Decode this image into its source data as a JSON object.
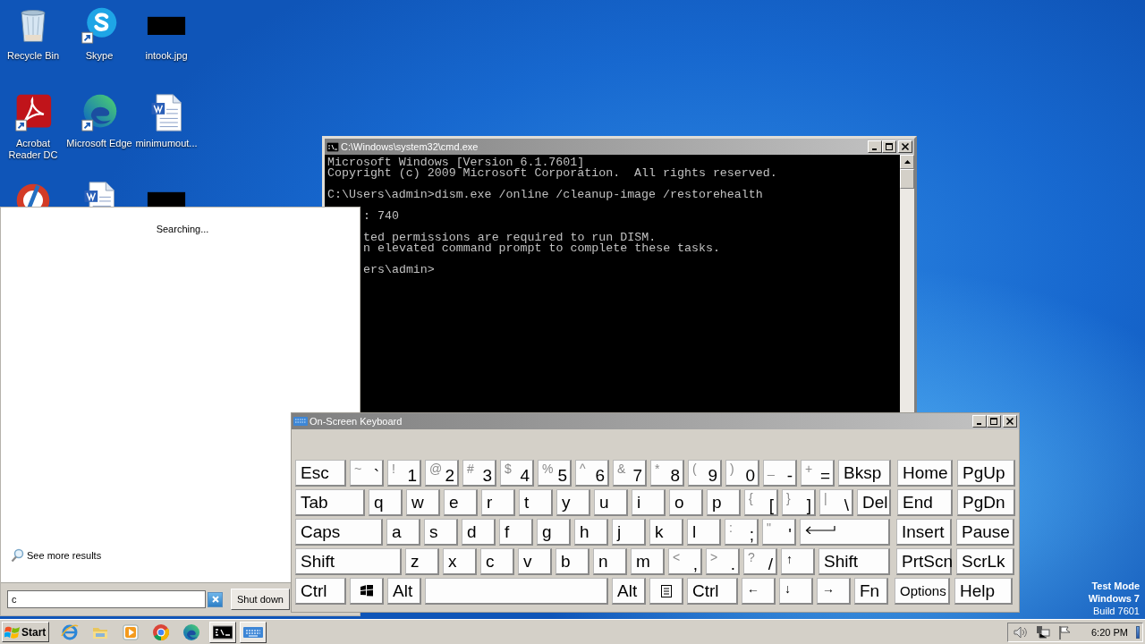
{
  "desktop": {
    "icons": [
      {
        "kind": "recycle",
        "label": "Recycle Bin",
        "shortcut": false
      },
      {
        "kind": "skype",
        "label": "Skype",
        "shortcut": true
      },
      {
        "kind": "image",
        "label": "intook.jpg",
        "shortcut": false
      },
      {
        "kind": "acrobat",
        "label": "Acrobat Reader DC",
        "shortcut": true
      },
      {
        "kind": "edge",
        "label": "Microsoft Edge",
        "shortcut": true
      },
      {
        "kind": "word",
        "label": "minimumout...",
        "shortcut": false
      },
      {
        "kind": "ccleaner"
      },
      {
        "kind": "word"
      },
      {
        "kind": "image"
      }
    ],
    "test_mode": [
      "Test Mode",
      "Windows 7",
      "Build 7601"
    ]
  },
  "cmd_window": {
    "title": "C:\\Windows\\system32\\cmd.exe",
    "blocks": [
      [
        {
          "text": "Microsoft Windows [Version 6.1.7601]",
          "cut": false
        },
        {
          "text": "Copyright (c) 2009 Microsoft Corporation.  All rights reserved.",
          "cut": false
        }
      ],
      [
        {
          "text": "C:\\Users\\admin>dism.exe /online /cleanup-image /restorehealth",
          "cut": false
        }
      ],
      [
        {
          "text": ": 740",
          "cut": true
        }
      ],
      [
        {
          "text": "ted permissions are required to run DISM.",
          "cut": true
        },
        {
          "text": "n elevated command prompt to complete these tasks.",
          "cut": true
        }
      ],
      [
        {
          "text": "ers\\admin>",
          "cut": true
        }
      ]
    ]
  },
  "start_menu": {
    "status": "Searching...",
    "see_more": "See more results",
    "search": {
      "value": "c"
    },
    "shutdown": "Shut down"
  },
  "keyboard_window": {
    "title": "On-Screen Keyboard",
    "rows": [
      {
        "keys": [
          {
            "kind": "esc",
            "label": "Esc"
          },
          {
            "kind": "key",
            "shift": "~",
            "label": "`"
          },
          {
            "kind": "key",
            "shift": "!",
            "label": "1"
          },
          {
            "kind": "key",
            "shift": "@",
            "label": "2"
          },
          {
            "kind": "key",
            "shift": "#",
            "label": "3"
          },
          {
            "kind": "key",
            "shift": "$",
            "label": "4"
          },
          {
            "kind": "key",
            "shift": "%",
            "label": "5"
          },
          {
            "kind": "key",
            "shift": "^",
            "label": "6"
          },
          {
            "kind": "key",
            "shift": "&",
            "label": "7"
          },
          {
            "kind": "key",
            "shift": "*",
            "label": "8"
          },
          {
            "kind": "key",
            "shift": "(",
            "label": "9"
          },
          {
            "kind": "key",
            "shift": ")",
            "label": "0"
          },
          {
            "kind": "key",
            "shift": "_",
            "label": "-"
          },
          {
            "kind": "key",
            "shift": "+",
            "label": "="
          },
          {
            "kind": "bksp",
            "label": "Bksp"
          }
        ],
        "nav": [
          {
            "kind": "nav",
            "label": "Home"
          },
          {
            "kind": "nav",
            "label": "PgUp"
          }
        ]
      },
      {
        "keys": [
          {
            "kind": "tab",
            "label": "Tab"
          },
          {
            "kind": "key",
            "label": "q"
          },
          {
            "kind": "key",
            "label": "w"
          },
          {
            "kind": "key",
            "label": "e"
          },
          {
            "kind": "key",
            "label": "r"
          },
          {
            "kind": "key",
            "label": "t"
          },
          {
            "kind": "key",
            "label": "y"
          },
          {
            "kind": "key",
            "label": "u"
          },
          {
            "kind": "key",
            "label": "i"
          },
          {
            "kind": "key",
            "label": "o"
          },
          {
            "kind": "key",
            "label": "p"
          },
          {
            "kind": "key",
            "shift": "{",
            "label": "["
          },
          {
            "kind": "key",
            "shift": "}",
            "label": "]"
          },
          {
            "kind": "key",
            "shift": "|",
            "label": "\\"
          },
          {
            "kind": "key",
            "label": "Del"
          }
        ],
        "nav": [
          {
            "kind": "nav",
            "label": "End"
          },
          {
            "kind": "nav",
            "label": "PgDn"
          }
        ]
      },
      {
        "keys": [
          {
            "kind": "caps",
            "label": "Caps"
          },
          {
            "kind": "key",
            "label": "a"
          },
          {
            "kind": "key",
            "label": "s"
          },
          {
            "kind": "key",
            "label": "d"
          },
          {
            "kind": "key",
            "label": "f"
          },
          {
            "kind": "key",
            "label": "g"
          },
          {
            "kind": "key",
            "label": "h"
          },
          {
            "kind": "key",
            "label": "j"
          },
          {
            "kind": "key",
            "label": "k"
          },
          {
            "kind": "key",
            "label": "l"
          },
          {
            "kind": "key",
            "shift": ":",
            "label": ";"
          },
          {
            "kind": "key",
            "shift": "\"",
            "label": "'"
          },
          {
            "kind": "enter"
          }
        ],
        "nav": [
          {
            "kind": "nav",
            "label": "Insert"
          },
          {
            "kind": "nav",
            "label": "Pause"
          }
        ]
      },
      {
        "keys": [
          {
            "kind": "lshift",
            "label": "Shift"
          },
          {
            "kind": "key",
            "label": "z"
          },
          {
            "kind": "key",
            "label": "x"
          },
          {
            "kind": "key",
            "label": "c"
          },
          {
            "kind": "key",
            "label": "v"
          },
          {
            "kind": "key",
            "label": "b"
          },
          {
            "kind": "key",
            "label": "n"
          },
          {
            "kind": "key",
            "label": "m"
          },
          {
            "kind": "key",
            "shift": "<",
            "label": ","
          },
          {
            "kind": "key",
            "shift": ">",
            "label": "."
          },
          {
            "kind": "key",
            "shift": "?",
            "label": "/"
          },
          {
            "kind": "arrow",
            "label": "↑"
          },
          {
            "kind": "rshift",
            "label": "Shift"
          }
        ],
        "nav": [
          {
            "kind": "nav",
            "label": "PrtScn"
          },
          {
            "kind": "nav",
            "label": "ScrLk"
          }
        ]
      },
      {
        "keys": [
          {
            "kind": "ctrl",
            "label": "Ctrl"
          },
          {
            "kind": "win"
          },
          {
            "kind": "key",
            "label": "Alt"
          },
          {
            "kind": "space"
          },
          {
            "kind": "key",
            "label": "Alt"
          },
          {
            "kind": "menu"
          },
          {
            "kind": "ctrl",
            "label": "Ctrl"
          },
          {
            "kind": "arrow",
            "label": "←"
          },
          {
            "kind": "arrow",
            "label": "↓"
          },
          {
            "kind": "arrow",
            "label": "→"
          },
          {
            "kind": "key",
            "label": "Fn"
          }
        ],
        "nav": [
          {
            "kind": "small",
            "label": "Options"
          },
          {
            "kind": "nav",
            "label": "Help"
          }
        ]
      }
    ]
  },
  "taskbar": {
    "start": "Start",
    "apps": [
      {
        "kind": "ie",
        "open": false
      },
      {
        "kind": "folder",
        "open": false
      },
      {
        "kind": "media",
        "open": false
      },
      {
        "kind": "chrome",
        "open": false
      },
      {
        "kind": "edge",
        "open": false
      },
      {
        "kind": "cmd",
        "open": true
      },
      {
        "kind": "keyboard",
        "open": true
      }
    ],
    "clock": "6:20 PM"
  }
}
